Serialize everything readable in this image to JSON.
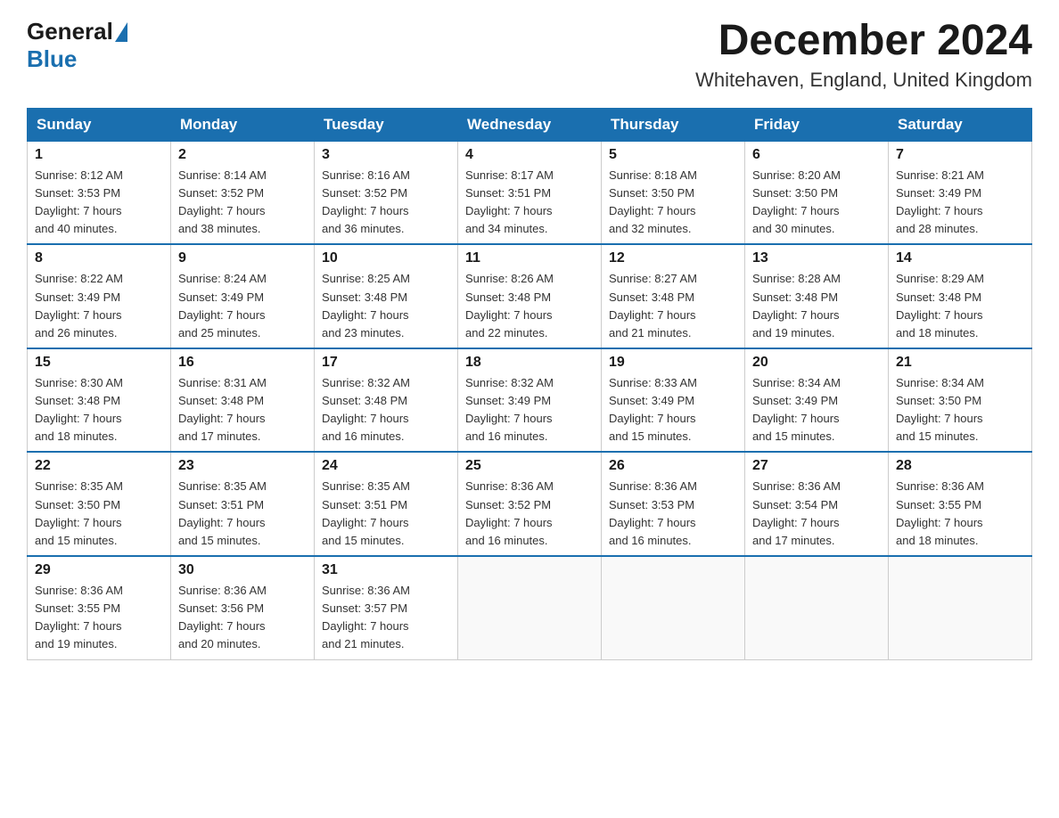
{
  "header": {
    "logo_general": "General",
    "logo_blue": "Blue",
    "title": "December 2024",
    "subtitle": "Whitehaven, England, United Kingdom"
  },
  "weekdays": [
    "Sunday",
    "Monday",
    "Tuesday",
    "Wednesday",
    "Thursday",
    "Friday",
    "Saturday"
  ],
  "weeks": [
    [
      {
        "day": "1",
        "info": "Sunrise: 8:12 AM\nSunset: 3:53 PM\nDaylight: 7 hours\nand 40 minutes."
      },
      {
        "day": "2",
        "info": "Sunrise: 8:14 AM\nSunset: 3:52 PM\nDaylight: 7 hours\nand 38 minutes."
      },
      {
        "day": "3",
        "info": "Sunrise: 8:16 AM\nSunset: 3:52 PM\nDaylight: 7 hours\nand 36 minutes."
      },
      {
        "day": "4",
        "info": "Sunrise: 8:17 AM\nSunset: 3:51 PM\nDaylight: 7 hours\nand 34 minutes."
      },
      {
        "day": "5",
        "info": "Sunrise: 8:18 AM\nSunset: 3:50 PM\nDaylight: 7 hours\nand 32 minutes."
      },
      {
        "day": "6",
        "info": "Sunrise: 8:20 AM\nSunset: 3:50 PM\nDaylight: 7 hours\nand 30 minutes."
      },
      {
        "day": "7",
        "info": "Sunrise: 8:21 AM\nSunset: 3:49 PM\nDaylight: 7 hours\nand 28 minutes."
      }
    ],
    [
      {
        "day": "8",
        "info": "Sunrise: 8:22 AM\nSunset: 3:49 PM\nDaylight: 7 hours\nand 26 minutes."
      },
      {
        "day": "9",
        "info": "Sunrise: 8:24 AM\nSunset: 3:49 PM\nDaylight: 7 hours\nand 25 minutes."
      },
      {
        "day": "10",
        "info": "Sunrise: 8:25 AM\nSunset: 3:48 PM\nDaylight: 7 hours\nand 23 minutes."
      },
      {
        "day": "11",
        "info": "Sunrise: 8:26 AM\nSunset: 3:48 PM\nDaylight: 7 hours\nand 22 minutes."
      },
      {
        "day": "12",
        "info": "Sunrise: 8:27 AM\nSunset: 3:48 PM\nDaylight: 7 hours\nand 21 minutes."
      },
      {
        "day": "13",
        "info": "Sunrise: 8:28 AM\nSunset: 3:48 PM\nDaylight: 7 hours\nand 19 minutes."
      },
      {
        "day": "14",
        "info": "Sunrise: 8:29 AM\nSunset: 3:48 PM\nDaylight: 7 hours\nand 18 minutes."
      }
    ],
    [
      {
        "day": "15",
        "info": "Sunrise: 8:30 AM\nSunset: 3:48 PM\nDaylight: 7 hours\nand 18 minutes."
      },
      {
        "day": "16",
        "info": "Sunrise: 8:31 AM\nSunset: 3:48 PM\nDaylight: 7 hours\nand 17 minutes."
      },
      {
        "day": "17",
        "info": "Sunrise: 8:32 AM\nSunset: 3:48 PM\nDaylight: 7 hours\nand 16 minutes."
      },
      {
        "day": "18",
        "info": "Sunrise: 8:32 AM\nSunset: 3:49 PM\nDaylight: 7 hours\nand 16 minutes."
      },
      {
        "day": "19",
        "info": "Sunrise: 8:33 AM\nSunset: 3:49 PM\nDaylight: 7 hours\nand 15 minutes."
      },
      {
        "day": "20",
        "info": "Sunrise: 8:34 AM\nSunset: 3:49 PM\nDaylight: 7 hours\nand 15 minutes."
      },
      {
        "day": "21",
        "info": "Sunrise: 8:34 AM\nSunset: 3:50 PM\nDaylight: 7 hours\nand 15 minutes."
      }
    ],
    [
      {
        "day": "22",
        "info": "Sunrise: 8:35 AM\nSunset: 3:50 PM\nDaylight: 7 hours\nand 15 minutes."
      },
      {
        "day": "23",
        "info": "Sunrise: 8:35 AM\nSunset: 3:51 PM\nDaylight: 7 hours\nand 15 minutes."
      },
      {
        "day": "24",
        "info": "Sunrise: 8:35 AM\nSunset: 3:51 PM\nDaylight: 7 hours\nand 15 minutes."
      },
      {
        "day": "25",
        "info": "Sunrise: 8:36 AM\nSunset: 3:52 PM\nDaylight: 7 hours\nand 16 minutes."
      },
      {
        "day": "26",
        "info": "Sunrise: 8:36 AM\nSunset: 3:53 PM\nDaylight: 7 hours\nand 16 minutes."
      },
      {
        "day": "27",
        "info": "Sunrise: 8:36 AM\nSunset: 3:54 PM\nDaylight: 7 hours\nand 17 minutes."
      },
      {
        "day": "28",
        "info": "Sunrise: 8:36 AM\nSunset: 3:55 PM\nDaylight: 7 hours\nand 18 minutes."
      }
    ],
    [
      {
        "day": "29",
        "info": "Sunrise: 8:36 AM\nSunset: 3:55 PM\nDaylight: 7 hours\nand 19 minutes."
      },
      {
        "day": "30",
        "info": "Sunrise: 8:36 AM\nSunset: 3:56 PM\nDaylight: 7 hours\nand 20 minutes."
      },
      {
        "day": "31",
        "info": "Sunrise: 8:36 AM\nSunset: 3:57 PM\nDaylight: 7 hours\nand 21 minutes."
      },
      {
        "day": "",
        "info": ""
      },
      {
        "day": "",
        "info": ""
      },
      {
        "day": "",
        "info": ""
      },
      {
        "day": "",
        "info": ""
      }
    ]
  ]
}
